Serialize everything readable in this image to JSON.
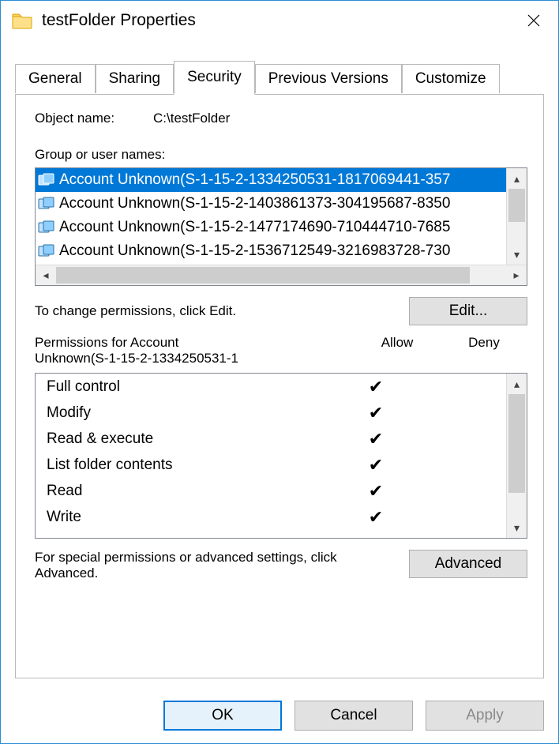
{
  "window": {
    "title": "testFolder Properties"
  },
  "tabs": {
    "items": [
      {
        "label": "General"
      },
      {
        "label": "Sharing"
      },
      {
        "label": "Security"
      },
      {
        "label": "Previous Versions"
      },
      {
        "label": "Customize"
      }
    ],
    "active_index": 2
  },
  "security": {
    "object_label": "Object name:",
    "object_value": "C:\\testFolder",
    "group_label": "Group or user names:",
    "users": [
      "Account Unknown(S-1-15-2-1334250531-1817069441-357",
      "Account Unknown(S-1-15-2-1403861373-304195687-8350",
      "Account Unknown(S-1-15-2-1477174690-710444710-7685",
      "Account Unknown(S-1-15-2-1536712549-3216983728-730"
    ],
    "selected_user_index": 0,
    "edit_hint": "To change permissions, click Edit.",
    "edit_button": "Edit...",
    "perm_title_line1": "Permissions for Account",
    "perm_title_line2": "Unknown(S-1-15-2-1334250531-1",
    "col_allow": "Allow",
    "col_deny": "Deny",
    "permissions": [
      {
        "name": "Full control",
        "allow": true,
        "deny": false
      },
      {
        "name": "Modify",
        "allow": true,
        "deny": false
      },
      {
        "name": "Read & execute",
        "allow": true,
        "deny": false
      },
      {
        "name": "List folder contents",
        "allow": true,
        "deny": false
      },
      {
        "name": "Read",
        "allow": true,
        "deny": false
      },
      {
        "name": "Write",
        "allow": true,
        "deny": false
      }
    ],
    "advanced_hint": "For special permissions or advanced settings, click Advanced.",
    "advanced_button": "Advanced"
  },
  "buttons": {
    "ok": "OK",
    "cancel": "Cancel",
    "apply": "Apply"
  }
}
